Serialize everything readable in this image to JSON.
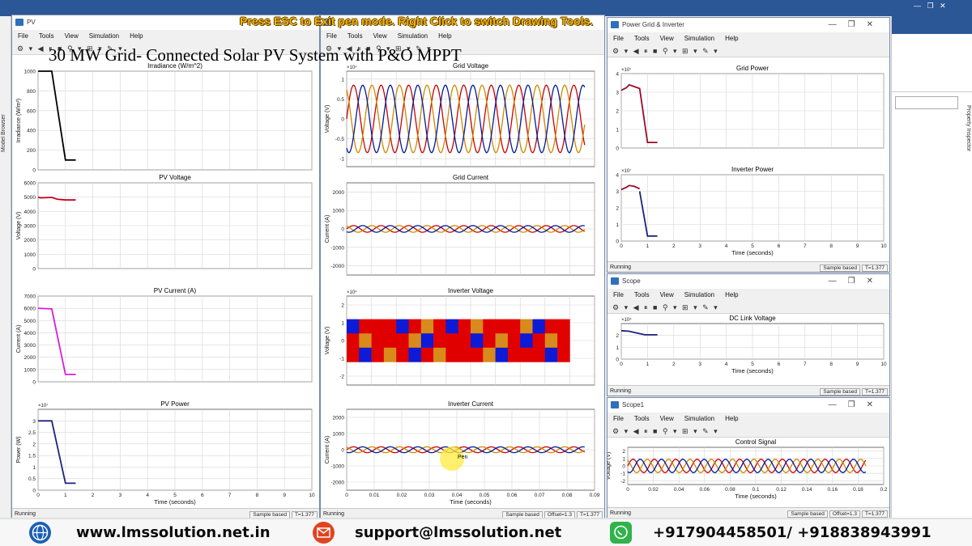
{
  "banner": {
    "pen_mode": "Press ESC to Exit pen mode.  Right Click to switch Drawing Tools.",
    "title": "30 MW Grid- Connected Solar PV System with P&O MPPT",
    "pen_label": "Pen"
  },
  "menus": [
    "File",
    "Tools",
    "View",
    "Simulation",
    "Help"
  ],
  "host": {
    "left_tab": "Model Browser",
    "right_tab": "Property Inspector"
  },
  "windows": {
    "pv": {
      "title": "PV",
      "status_left": "Running",
      "status_right": [
        "Sample based",
        "T=1.377"
      ]
    },
    "grid": {
      "title": "",
      "status_left": "Running",
      "status_right": [
        "Sample based",
        "Offset=1.3",
        "T=1.377"
      ]
    },
    "power": {
      "title": "Power Grid & Inverter",
      "status_left": "Running",
      "status_right": [
        "Sample based",
        "T=1.377"
      ]
    },
    "scope": {
      "title": "Scope",
      "status_left": "Running",
      "status_right": [
        "Sample based",
        "T=1.377"
      ]
    },
    "scope1": {
      "title": "Scope1",
      "status_left": "Running",
      "status_right": [
        "Sample based",
        "Offset=1.3",
        "T=1.377"
      ]
    }
  },
  "chart_data": [
    {
      "type": "line",
      "title": "Irradiance (W/m^2)",
      "ylabel": "Irradiance (W/m²)",
      "xlabel": "",
      "xlim": [
        0,
        10
      ],
      "ylim": [
        0,
        1000
      ],
      "yticks": [
        0,
        200,
        400,
        600,
        800,
        1000
      ],
      "series": [
        {
          "color": "#000000",
          "x": [
            0,
            0.5,
            1.0,
            1.377
          ],
          "y": [
            1000,
            1000,
            100,
            100
          ]
        }
      ]
    },
    {
      "type": "line",
      "title": "PV Voltage",
      "ylabel": "Voltage (V)",
      "xlabel": "",
      "xlim": [
        0,
        10
      ],
      "ylim": [
        0,
        6000
      ],
      "yticks": [
        0,
        1000,
        2000,
        3000,
        4000,
        5000,
        6000
      ],
      "series": [
        {
          "color": "#c0001a",
          "x": [
            0,
            0.1,
            0.5,
            0.7,
            1.0,
            1.377
          ],
          "y": [
            5000,
            4950,
            4980,
            4850,
            4800,
            4800
          ]
        }
      ]
    },
    {
      "type": "line",
      "title": "PV Current (A)",
      "ylabel": "Current (A)",
      "xlabel": "",
      "xlim": [
        0,
        10
      ],
      "ylim": [
        0,
        7000
      ],
      "yticks": [
        0,
        1000,
        2000,
        3000,
        4000,
        5000,
        6000,
        7000
      ],
      "series": [
        {
          "color": "#d51fd5",
          "x": [
            0,
            0.5,
            1.0,
            1.377
          ],
          "y": [
            6000,
            5950,
            600,
            600
          ]
        }
      ]
    },
    {
      "type": "line",
      "title": "PV Power",
      "ylabel": "Power (W)",
      "xlabel": "Time (seconds)",
      "exponent": "×10⁷",
      "xlim": [
        0,
        10
      ],
      "ylim": [
        0,
        3.5
      ],
      "xticks": [
        0,
        1,
        2,
        3,
        4,
        5,
        6,
        7,
        8,
        9,
        10
      ],
      "yticks": [
        0,
        0.5,
        1,
        1.5,
        2,
        2.5,
        3
      ],
      "series": [
        {
          "color": "#1a237e",
          "x": [
            0,
            0.5,
            1.0,
            1.377
          ],
          "y": [
            3.0,
            3.0,
            0.3,
            0.3
          ]
        }
      ]
    },
    {
      "type": "line",
      "title": "Grid Voltage",
      "ylabel": "Voltage (V)",
      "xlabel": "",
      "exponent": "×10⁴",
      "xlim": [
        0,
        0.09
      ],
      "ylim": [
        -1.2,
        1.2
      ],
      "yticks": [
        -1,
        -0.5,
        0,
        0.5,
        1
      ],
      "series": [
        {
          "color": "#cc0000",
          "wave": "sine",
          "amplitude": 0.85,
          "frequency": 100,
          "phase": 0
        },
        {
          "color": "#cc8a00",
          "wave": "sine",
          "amplitude": 0.85,
          "frequency": 100,
          "phase": 2.094
        },
        {
          "color": "#001a99",
          "wave": "sine",
          "amplitude": 0.85,
          "frequency": 100,
          "phase": -2.094
        }
      ]
    },
    {
      "type": "line",
      "title": "Grid Current",
      "ylabel": "Current (A)",
      "xlabel": "",
      "xlim": [
        0,
        0.09
      ],
      "ylim": [
        -2500,
        2500
      ],
      "yticks": [
        -2000,
        -1000,
        0,
        1000,
        2000
      ],
      "series": [
        {
          "color": "#cc0000",
          "wave": "sine",
          "amplitude": 180,
          "frequency": 100,
          "phase": 0
        },
        {
          "color": "#cc8a00",
          "wave": "sine",
          "amplitude": 180,
          "frequency": 100,
          "phase": 2.094
        },
        {
          "color": "#001a99",
          "wave": "sine",
          "amplitude": 180,
          "frequency": 100,
          "phase": -2.094
        }
      ]
    },
    {
      "type": "heatmap",
      "title": "Inverter Voltage",
      "ylabel": "Voltage (V)",
      "xlabel": "",
      "exponent": "×10⁴",
      "xlim": [
        0,
        0.09
      ],
      "ylim": [
        -2.5,
        2.5
      ],
      "yticks": [
        -2,
        -1,
        0,
        1,
        2
      ],
      "band": [
        -1.2,
        1.2
      ],
      "series": [
        {
          "color": "#e00000",
          "name": ""
        },
        {
          "color": "#0d1bd6",
          "name": ""
        },
        {
          "color": "#d88a1b",
          "name": ""
        }
      ]
    },
    {
      "type": "line",
      "title": "Inverter Current",
      "ylabel": "Current (A)",
      "xlabel": "Time (seconds)",
      "xlim": [
        0,
        0.09
      ],
      "ylim": [
        -2500,
        2500
      ],
      "xticks": [
        0,
        0.01,
        0.02,
        0.03,
        0.04,
        0.05,
        0.06,
        0.07,
        0.08,
        0.09
      ],
      "yticks": [
        -2000,
        -1000,
        0,
        1000,
        2000
      ],
      "series": [
        {
          "color": "#cc0000",
          "wave": "sine",
          "amplitude": 180,
          "frequency": 100,
          "phase": 0
        },
        {
          "color": "#cc8a00",
          "wave": "sine",
          "amplitude": 180,
          "frequency": 100,
          "phase": 2.094
        },
        {
          "color": "#001a99",
          "wave": "sine",
          "amplitude": 180,
          "frequency": 100,
          "phase": -2.094
        }
      ]
    },
    {
      "type": "line",
      "title": "Grid Power",
      "ylabel": "Power (W)",
      "xlabel": "",
      "exponent": "×10⁷",
      "xlim": [
        0,
        10
      ],
      "ylim": [
        0,
        4
      ],
      "yticks": [
        0,
        1,
        2,
        3,
        4
      ],
      "series": [
        {
          "color": "#9b0a2a",
          "x": [
            0,
            0.2,
            0.3,
            0.5,
            0.7,
            1.0,
            1.377
          ],
          "y": [
            3.1,
            3.25,
            3.4,
            3.3,
            3.2,
            0.3,
            0.3
          ]
        }
      ]
    },
    {
      "type": "line",
      "title": "Inverter Power",
      "ylabel": "Power (W)",
      "xlabel": "Time (seconds)",
      "exponent": "×10⁷",
      "xlim": [
        0,
        10
      ],
      "ylim": [
        0,
        4
      ],
      "xticks": [
        0,
        1,
        2,
        3,
        4,
        5,
        6,
        7,
        8,
        9,
        10
      ],
      "yticks": [
        0,
        1,
        2,
        3,
        4
      ],
      "series": [
        {
          "color": "#9b0a2a",
          "x": [
            0,
            0.2,
            0.3,
            0.5,
            0.7
          ],
          "y": [
            3.1,
            3.25,
            3.35,
            3.3,
            3.15
          ]
        },
        {
          "color": "#1a237e",
          "x": [
            0.7,
            1.0,
            1.377
          ],
          "y": [
            3.0,
            0.3,
            0.3
          ]
        }
      ]
    },
    {
      "type": "line",
      "title": "DC Link Voltage",
      "ylabel": "Voltage (V)",
      "xlabel": "Time (seconds)",
      "exponent": "×10⁴",
      "xlim": [
        0,
        10
      ],
      "ylim": [
        0,
        3
      ],
      "xticks": [
        0,
        1,
        2,
        3,
        4,
        5,
        6,
        7,
        8,
        9,
        10
      ],
      "yticks": [
        0,
        1,
        2
      ],
      "series": [
        {
          "color": "#1a237e",
          "x": [
            0,
            0.3,
            0.6,
            0.9,
            1.377
          ],
          "y": [
            2.4,
            2.35,
            2.2,
            2.05,
            2.05
          ]
        }
      ]
    },
    {
      "type": "line",
      "title": "Control Signal",
      "ylabel": "Voltage (V)",
      "xlabel": "Time (seconds)",
      "xlim": [
        0,
        0.2
      ],
      "ylim": [
        -2.5,
        2.5
      ],
      "xticks": [
        0,
        0.02,
        0.04,
        0.06,
        0.08,
        0.1,
        0.12,
        0.14,
        0.16,
        0.18,
        0.2
      ],
      "yticks": [
        -2,
        -1,
        0,
        1,
        2
      ],
      "series": [
        {
          "color": "#cc0000",
          "wave": "sine",
          "amplitude": 0.9,
          "frequency": 60,
          "phase": 0,
          "tmax": 0.186
        },
        {
          "color": "#cc8a00",
          "wave": "sine",
          "amplitude": 0.9,
          "frequency": 60,
          "phase": 2.094,
          "tmax": 0.186
        },
        {
          "color": "#001a99",
          "wave": "sine",
          "amplitude": 0.9,
          "frequency": 60,
          "phase": -2.094,
          "tmax": 0.186
        }
      ]
    }
  ],
  "footer": {
    "website": "www.lmssolution.net.in",
    "email": "support@lmssolution.net",
    "phone": "+917904458501/ +918838943991"
  }
}
